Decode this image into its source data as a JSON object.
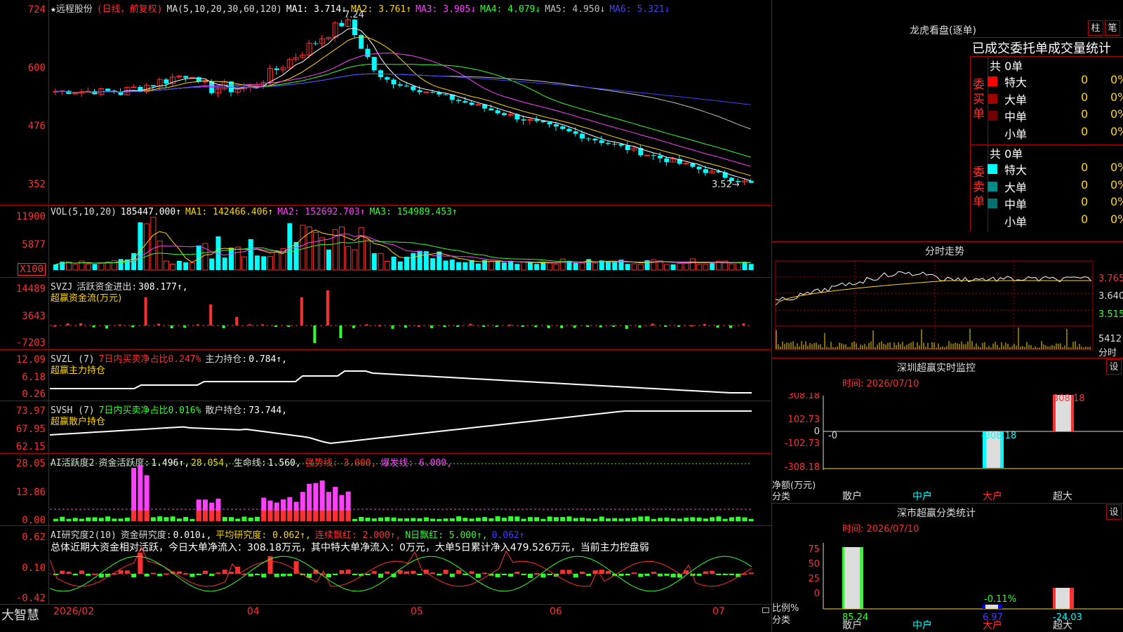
{
  "app": {
    "brand": "大智慧"
  },
  "kline": {
    "star": "★",
    "stock_name": "远程股份",
    "period": "(日线，前复权)",
    "ma_params": "MA(5,10,20,30,60,120)",
    "ma_values": [
      {
        "label": "MA1:",
        "value": "3.714↓",
        "color": "#ffffff"
      },
      {
        "label": "MA2:",
        "value": "3.761↑",
        "color": "#ffd700"
      },
      {
        "label": "MA3:",
        "value": "3.905↓",
        "color": "#ff40ff"
      },
      {
        "label": "MA4:",
        "value": "4.079↓",
        "color": "#30ff30"
      },
      {
        "label": "MA5:",
        "value": "4.950↓",
        "color": "#c0c0c0"
      },
      {
        "label": "MA6:",
        "value": "5.321↓",
        "color": "#4040ff"
      }
    ],
    "y_ticks": [
      "724",
      "600",
      "476",
      "352"
    ],
    "high_marker": "7.24",
    "low_marker": "3.52→"
  },
  "vol": {
    "params": "VOL(5,10,20)",
    "value": "185447.000↑",
    "ma": [
      {
        "label": "MA1:",
        "value": "142466.406↑",
        "color": "#ffd700"
      },
      {
        "label": "MA2:",
        "value": "152692.703↑",
        "color": "#ff40ff"
      },
      {
        "label": "MA3:",
        "value": "154989.453↑",
        "color": "#30ff30"
      }
    ],
    "y_ticks": [
      "11900",
      "5877"
    ],
    "unit": "X100"
  },
  "svzj": {
    "title": "SVZJ",
    "label": "活跃资金进出:",
    "value": "308.177↑,",
    "subtitle": "超赢资金流(万元)",
    "y_ticks": [
      "14489",
      "3643",
      "-7203"
    ]
  },
  "svzl": {
    "title": "SVZL (7)",
    "desc": "7日内买卖净占比0.247%",
    "label": "主力持仓:",
    "value": "0.784↑,",
    "subtitle": "超赢主力持仓",
    "y_ticks": [
      "12.09",
      "6.18",
      "0.26"
    ]
  },
  "svsh": {
    "title": "SVSH (7)",
    "desc": "7日内买卖净占比0.016%",
    "label": "散户持仓:",
    "value": "73.744,",
    "subtitle": "超赢散户持仓",
    "y_ticks": [
      "73.97",
      "67.95",
      "62.15"
    ]
  },
  "ai_active": {
    "title": "AI活跃度2",
    "label": "资金活跃度:",
    "value": "1.496↑,",
    "value2": "28.054,",
    "life_label": "生命线:",
    "life_value": "1.560,",
    "strong": "强势线: 3.000,",
    "burst": "爆发线: 6.000,",
    "y_ticks": [
      "28.05",
      "13.86",
      "0.00"
    ]
  },
  "ai_research": {
    "title": "AI研究度2(10)",
    "label": "资金研究度:",
    "value": "0.010↓,",
    "avg": "平均研究度: 0.062↑,",
    "red": "连续飘红: 2.000↑,",
    "nred": "N日飘红: 5.000↑,",
    "last": "0.062↑",
    "summary": "总体近期大资金相对活跃，今日大单净流入：308.18万元，其中特大单净流入：0万元，大单5日累计净入479.526万元，当前主力控盘弱",
    "y_ticks": [
      "0.62",
      "0.10",
      "-0.42"
    ]
  },
  "x_axis": [
    "2026/02",
    "04",
    "05",
    "06",
    "07"
  ],
  "right": {
    "lhb_title": "龙虎看盘(逐单)",
    "btn_zhu": "柱",
    "btn_bi": "笔",
    "stat_header": "已成交委托单成交量统计",
    "buy_label": "委买单",
    "sell_label": "委卖单",
    "buy_total": "共 0单",
    "sell_total": "共 0单",
    "buy_rows": [
      {
        "name": "特大",
        "count": "0",
        "pct": "0%",
        "color": "#ff0000"
      },
      {
        "name": "大单",
        "count": "0",
        "pct": "0%",
        "color": "#a00000"
      },
      {
        "name": "中单",
        "count": "0",
        "pct": "0%",
        "color": "#700000"
      },
      {
        "name": "小单",
        "count": "0",
        "pct": "0%",
        "color": ""
      }
    ],
    "sell_rows": [
      {
        "name": "特大",
        "count": "0",
        "pct": "0%",
        "color": "#00ffff"
      },
      {
        "name": "大单",
        "count": "0",
        "pct": "0%",
        "color": "#008b8b"
      },
      {
        "name": "中单",
        "count": "0",
        "pct": "0%",
        "color": "#007070"
      },
      {
        "name": "小单",
        "count": "0",
        "pct": "0%",
        "color": ""
      }
    ],
    "fenshi_title": "分时走势",
    "fenshi_ticks": [
      "3.765",
      "3.640",
      "3.515",
      "5412"
    ],
    "fenshi_corner": "分时",
    "monitor_title": "深圳超赢实时监控",
    "monitor_btn": "设",
    "monitor_time": "时间: 2026/07/10",
    "monitor_y": [
      "308.18",
      "102.73",
      "0",
      "-102.73",
      "-308.18"
    ],
    "monitor_unit": "净额(万元)",
    "monitor_cat_label": "分类",
    "monitor_vals": [
      "-0",
      "-308.18",
      "308.18",
      "0"
    ],
    "categories": [
      "散户",
      "中户",
      "大户",
      "超大"
    ],
    "class_title": "深市超赢分类统计",
    "class_btn": "设",
    "class_time": "时间: 2026/07/10",
    "class_y": [
      "75",
      "50",
      "25",
      "0"
    ],
    "class_unit": "比例%",
    "class_cat_label": "分类",
    "class_small_label": "-0.11%",
    "class_vals": [
      "85.24",
      "6.97",
      "-24.03",
      "31.82"
    ]
  },
  "colors": {
    "red": "#ff3030",
    "cyan": "#00ffff",
    "green": "#30ff30",
    "yellow": "#ffd700",
    "magenta": "#ff40ff",
    "border": "#b00000"
  }
}
